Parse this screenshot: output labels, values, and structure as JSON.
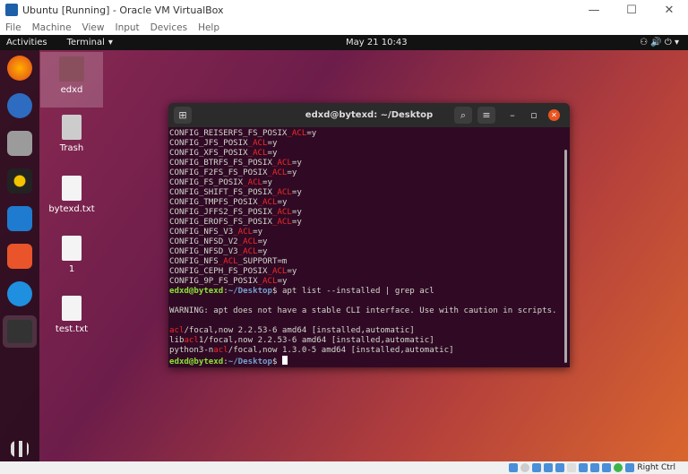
{
  "window": {
    "title": "Ubuntu [Running] - Oracle VM VirtualBox",
    "minimize": "—",
    "maximize": "☐",
    "close": "✕"
  },
  "menu": [
    "File",
    "Machine",
    "View",
    "Input",
    "Devices",
    "Help"
  ],
  "topbar": {
    "activities": "Activities",
    "app": "Terminal",
    "app_arrow": "▾",
    "clock": "May 21  10:43",
    "icons": "⚇ 🔊 ⏻ ▾"
  },
  "desktop_icons": [
    {
      "label": "edxd"
    },
    {
      "label": "Trash"
    },
    {
      "label": "bytexd.txt"
    },
    {
      "label": "1"
    },
    {
      "label": "test.txt"
    }
  ],
  "terminal": {
    "title": "edxd@bytexd: ~/Desktop",
    "lines": [
      [
        {
          "t": "CONFIG_REISERFS_FS_POSIX"
        },
        {
          "t": "_ACL",
          "c": "red"
        },
        {
          "t": "=y"
        }
      ],
      [
        {
          "t": "CONFIG_JFS_POSIX"
        },
        {
          "t": "_ACL",
          "c": "red"
        },
        {
          "t": "=y"
        }
      ],
      [
        {
          "t": "CONFIG_XFS_POSIX"
        },
        {
          "t": "_ACL",
          "c": "red"
        },
        {
          "t": "=y"
        }
      ],
      [
        {
          "t": "CONFIG_BTRFS_FS_POSIX"
        },
        {
          "t": "_ACL",
          "c": "red"
        },
        {
          "t": "=y"
        }
      ],
      [
        {
          "t": "CONFIG_F2FS_FS_POSIX"
        },
        {
          "t": "_ACL",
          "c": "red"
        },
        {
          "t": "=y"
        }
      ],
      [
        {
          "t": "CONFIG_FS_POSIX"
        },
        {
          "t": "_ACL",
          "c": "red"
        },
        {
          "t": "=y"
        }
      ],
      [
        {
          "t": "CONFIG_SHIFT_FS_POSIX"
        },
        {
          "t": "_ACL",
          "c": "red"
        },
        {
          "t": "=y"
        }
      ],
      [
        {
          "t": "CONFIG_TMPFS_POSIX"
        },
        {
          "t": "_ACL",
          "c": "red"
        },
        {
          "t": "=y"
        }
      ],
      [
        {
          "t": "CONFIG_JFFS2_FS_POSIX"
        },
        {
          "t": "_ACL",
          "c": "red"
        },
        {
          "t": "=y"
        }
      ],
      [
        {
          "t": "CONFIG_EROFS_FS_POSIX"
        },
        {
          "t": "_ACL",
          "c": "red"
        },
        {
          "t": "=y"
        }
      ],
      [
        {
          "t": "CONFIG_NFS_V3"
        },
        {
          "t": "_ACL",
          "c": "red"
        },
        {
          "t": "=y"
        }
      ],
      [
        {
          "t": "CONFIG_NFSD_V2"
        },
        {
          "t": "_ACL",
          "c": "red"
        },
        {
          "t": "=y"
        }
      ],
      [
        {
          "t": "CONFIG_NFSD_V3"
        },
        {
          "t": "_ACL",
          "c": "red"
        },
        {
          "t": "=y"
        }
      ],
      [
        {
          "t": "CONFIG_NFS"
        },
        {
          "t": "_ACL",
          "c": "red"
        },
        {
          "t": "_SUPPORT=m"
        }
      ],
      [
        {
          "t": "CONFIG_CEPH_FS_POSIX"
        },
        {
          "t": "_ACL",
          "c": "red"
        },
        {
          "t": "=y"
        }
      ],
      [
        {
          "t": "CONFIG_9P_FS_POSIX"
        },
        {
          "t": "_ACL",
          "c": "red"
        },
        {
          "t": "=y"
        }
      ],
      [
        {
          "t": "edxd@bytexd",
          "c": "green"
        },
        {
          "t": ":"
        },
        {
          "t": "~/Desktop",
          "c": "blue"
        },
        {
          "t": "$ apt list --installed | grep acl"
        }
      ],
      [
        {
          "t": ""
        }
      ],
      [
        {
          "t": "WARNING: apt does not have a stable CLI interface. Use with caution in scripts."
        }
      ],
      [
        {
          "t": ""
        }
      ],
      [
        {
          "t": "acl",
          "c": "red"
        },
        {
          "t": "/focal,now 2.2.53-6 amd64 [installed,automatic]"
        }
      ],
      [
        {
          "t": "lib"
        },
        {
          "t": "acl",
          "c": "red"
        },
        {
          "t": "1/focal,now 2.2.53-6 amd64 [installed,automatic]"
        }
      ],
      [
        {
          "t": "python3-n"
        },
        {
          "t": "acl",
          "c": "red"
        },
        {
          "t": "/focal,now 1.3.0-5 amd64 [installed,automatic]"
        }
      ],
      [
        {
          "t": "edxd@bytexd",
          "c": "green"
        },
        {
          "t": ":"
        },
        {
          "t": "~/Desktop",
          "c": "blue"
        },
        {
          "t": "$ "
        }
      ]
    ]
  },
  "status": {
    "host_key": "Right Ctrl"
  }
}
